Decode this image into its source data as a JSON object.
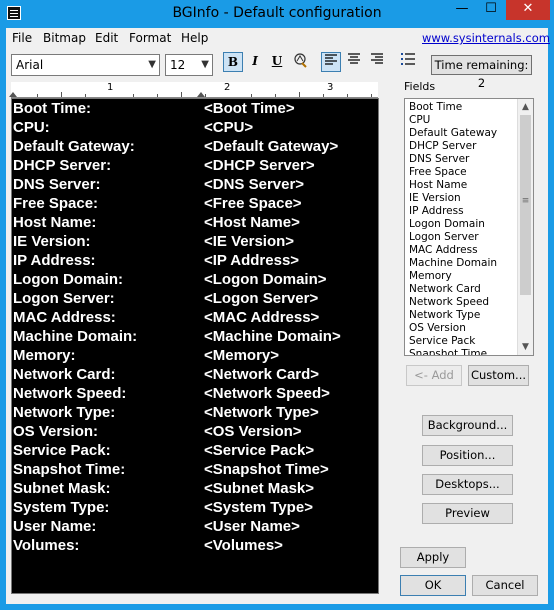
{
  "window": {
    "title": "BGInfo - Default configuration",
    "min_label": "—",
    "max_label": "☐",
    "close_label": "✕"
  },
  "menu": {
    "items": [
      "File",
      "Bitmap",
      "Edit",
      "Format",
      "Help"
    ],
    "link": "www.sysinternals.com"
  },
  "toolbar": {
    "font": "Arial",
    "size": "12",
    "bold_label": "B",
    "italic_label": "I",
    "underline_label": "U",
    "time_remaining": "Time remaining: 2"
  },
  "ruler": {
    "numbers": [
      "1",
      "2",
      "3"
    ]
  },
  "editor": {
    "rows": [
      {
        "label": "Boot Time:",
        "value": "<Boot Time>"
      },
      {
        "label": "CPU:",
        "value": "<CPU>"
      },
      {
        "label": "Default Gateway:",
        "value": "<Default Gateway>"
      },
      {
        "label": "DHCP Server:",
        "value": "<DHCP Server>"
      },
      {
        "label": "DNS Server:",
        "value": "<DNS Server>"
      },
      {
        "label": "Free Space:",
        "value": "<Free Space>"
      },
      {
        "label": "Host Name:",
        "value": "<Host Name>"
      },
      {
        "label": "IE Version:",
        "value": "<IE Version>"
      },
      {
        "label": "IP Address:",
        "value": "<IP Address>"
      },
      {
        "label": "Logon Domain:",
        "value": "<Logon Domain>"
      },
      {
        "label": "Logon Server:",
        "value": "<Logon Server>"
      },
      {
        "label": "MAC Address:",
        "value": "<MAC Address>"
      },
      {
        "label": "Machine Domain:",
        "value": "<Machine Domain>"
      },
      {
        "label": "Memory:",
        "value": "<Memory>"
      },
      {
        "label": "Network Card:",
        "value": "<Network Card>"
      },
      {
        "label": "Network Speed:",
        "value": "<Network Speed>"
      },
      {
        "label": "Network Type:",
        "value": "<Network Type>"
      },
      {
        "label": "OS Version:",
        "value": "<OS Version>"
      },
      {
        "label": "Service Pack:",
        "value": "<Service Pack>"
      },
      {
        "label": "Snapshot Time:",
        "value": "<Snapshot Time>"
      },
      {
        "label": "Subnet Mask:",
        "value": "<Subnet Mask>"
      },
      {
        "label": "System Type:",
        "value": "<System Type>"
      },
      {
        "label": "User Name:",
        "value": "<User Name>"
      },
      {
        "label": "Volumes:",
        "value": "<Volumes>"
      }
    ]
  },
  "fields": {
    "label": "Fields",
    "items": [
      "Boot Time",
      "CPU",
      "Default Gateway",
      "DHCP Server",
      "DNS Server",
      "Free Space",
      "Host Name",
      "IE Version",
      "IP Address",
      "Logon Domain",
      "Logon Server",
      "MAC Address",
      "Machine Domain",
      "Memory",
      "Network Card",
      "Network Speed",
      "Network Type",
      "OS Version",
      "Service Pack",
      "Snapshot Time"
    ],
    "add_label": "<- Add",
    "custom_label": "Custom..."
  },
  "buttons": {
    "background": "Background...",
    "position": "Position...",
    "desktops": "Desktops...",
    "preview": "Preview",
    "apply": "Apply",
    "ok": "OK",
    "cancel": "Cancel"
  }
}
